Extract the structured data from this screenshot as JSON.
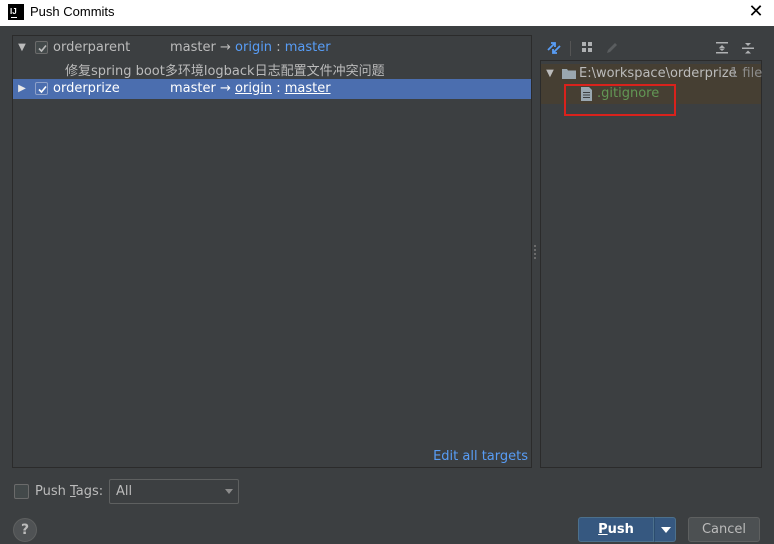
{
  "window": {
    "app_icon": "IJ",
    "title": "Push Commits",
    "close_glyph": "✕"
  },
  "commits_panel": {
    "repos": [
      {
        "name": "orderparent",
        "checked": true,
        "expanded": true,
        "selected": false,
        "local_branch": "master",
        "arrow": "→",
        "remote": "origin",
        "separator": ":",
        "remote_branch": "master",
        "commits": [
          "修复spring boot多环境logback日志配置文件冲突问题"
        ]
      },
      {
        "name": "orderprize",
        "checked": true,
        "expanded": false,
        "selected": true,
        "local_branch": "master",
        "arrow": "→",
        "remote": "origin",
        "separator": ":",
        "remote_branch": "master"
      }
    ],
    "edit_all_targets": "Edit all targets"
  },
  "files_panel": {
    "toolbar_icons": [
      "diff-icon",
      "group-by-icon",
      "edit-icon",
      "expand-all-icon",
      "collapse-all-icon"
    ],
    "directory": {
      "path": "E:\\workspace\\orderprize",
      "count": "1 file"
    },
    "files": [
      ".gitignore"
    ]
  },
  "bottom": {
    "push_tags_label_pre": "Push ",
    "push_tags_label_u": "T",
    "push_tags_label_post": "ags:",
    "push_tags_checked": false,
    "tags_select_value": "All",
    "help_label": "?",
    "push_label_u": "P",
    "push_label_rest": "ush",
    "cancel_label": "Cancel"
  },
  "colors": {
    "background": "#3c3f41",
    "selection": "#4b6eaf",
    "link": "#589df6",
    "new_file": "#629755",
    "primary_button": "#365880",
    "highlight_border": "#d9221c"
  }
}
